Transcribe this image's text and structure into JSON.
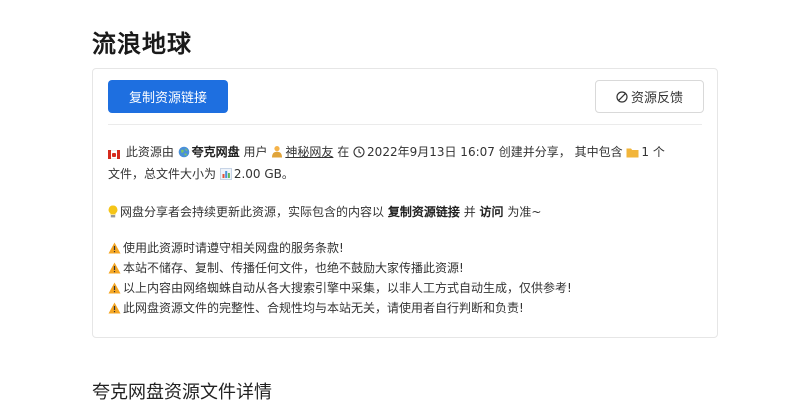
{
  "page": {
    "title": "流浪地球",
    "section_title": "夸克网盘资源文件详情"
  },
  "actions": {
    "copy_link_label": "复制资源链接",
    "feedback_label": "资源反馈"
  },
  "info": {
    "prefix": "此资源由",
    "disk_name": "夸克网盘",
    "user_label": "用户",
    "user_name": "神秘网友",
    "at_label": "在",
    "created_time": "2022年9月13日 16:07",
    "created_suffix": "创建并分享，",
    "contains_label": "其中包含",
    "file_count": "1",
    "count_suffix_1": "个",
    "count_suffix_2": "文件，总文件大小为",
    "total_size": "2.00 GB",
    "end_period": "。"
  },
  "tip": {
    "text_1": "网盘分享者会持续更新此资源，实际包含的内容以",
    "emph_1": "复制资源链接",
    "text_2": "并",
    "emph_2": "访问",
    "text_3": "为准~"
  },
  "warnings": [
    "使用此资源时请遵守相关网盘的服务条款!",
    "本站不储存、复制、传播任何文件，也绝不鼓励大家传播此资源!",
    "以上内容由网络蜘蛛自动从各大搜索引擎中采集，以非人工方式自动生成，仅供参考!",
    "此网盘资源文件的完整性、合规性均与本站无关，请使用者自行判断和负责!"
  ],
  "colors": {
    "primary": "#1e6fe0",
    "warning": "#f5a623",
    "folder": "#f2b53a"
  },
  "icons": {
    "flag": "canada-flag-icon",
    "globe": "globe-icon",
    "user": "user-icon",
    "clock": "clock-icon",
    "folder": "folder-icon",
    "size": "bar-chart-icon",
    "tip": "lightbulb-icon",
    "warning": "warning-icon",
    "feedback": "ban-icon"
  }
}
